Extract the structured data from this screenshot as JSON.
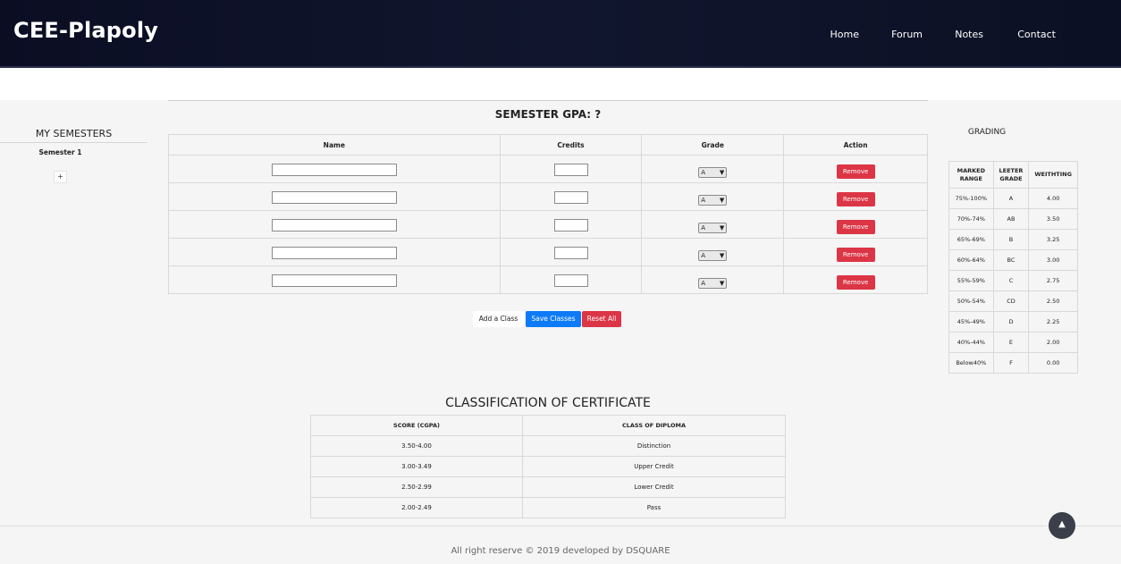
{
  "header": {
    "brand": "CEE-Plapoly",
    "nav": [
      "Home",
      "Forum",
      "Notes",
      "Contact"
    ]
  },
  "sidebar": {
    "title": "MY SEMESTERS",
    "items": [
      "Semester 1"
    ],
    "add_label": "+"
  },
  "semester": {
    "title": "SEMESTER GPA: ?",
    "columns": [
      "Name",
      "Credits",
      "Grade",
      "Action"
    ],
    "rows": [
      {
        "name": "",
        "credits": "",
        "grade": "A",
        "action": "Remove"
      },
      {
        "name": "",
        "credits": "",
        "grade": "A",
        "action": "Remove"
      },
      {
        "name": "",
        "credits": "",
        "grade": "A",
        "action": "Remove"
      },
      {
        "name": "",
        "credits": "",
        "grade": "A",
        "action": "Remove"
      },
      {
        "name": "",
        "credits": "",
        "grade": "A",
        "action": "Remove"
      }
    ],
    "add_class_label": "Add a Class",
    "save_label": "Save Classes",
    "reset_label": "Reset All"
  },
  "grading": {
    "title": "GRADING",
    "headers": [
      "MARKED RANGE",
      "LEETER GRADE",
      "WEITHTING"
    ],
    "rows": [
      [
        "75%-100%",
        "A",
        "4.00"
      ],
      [
        "70%-74%",
        "AB",
        "3.50"
      ],
      [
        "65%-69%",
        "B",
        "3.25"
      ],
      [
        "60%-64%",
        "BC",
        "3.00"
      ],
      [
        "55%-59%",
        "C",
        "2.75"
      ],
      [
        "50%-54%",
        "CD",
        "2.50"
      ],
      [
        "45%-49%",
        "D",
        "2.25"
      ],
      [
        "40%-44%",
        "E",
        "2.00"
      ],
      [
        "Below40%",
        "F",
        "0.00"
      ]
    ]
  },
  "classification": {
    "title": "CLASSIFICATION OF CERTIFICATE",
    "headers": [
      "SCORE (CGPA)",
      "CLASS OF DIPLOMA"
    ],
    "rows": [
      [
        "3.50-4.00",
        "Distinction"
      ],
      [
        "3.00-3.49",
        "Upper Credit"
      ],
      [
        "2.50-2.99",
        "Lower Credit"
      ],
      [
        "2.00-2.49",
        "Pass"
      ]
    ]
  },
  "footer": {
    "text": "All right reserve © 2019 developed by DSQUARE"
  },
  "icons": {
    "dropdown": "caret-down-icon",
    "scroll_top": "arrow-up-icon"
  },
  "colors": {
    "header_bg": "#0b0e23",
    "save": "#0d7bf7",
    "remove": "#dc3545"
  }
}
